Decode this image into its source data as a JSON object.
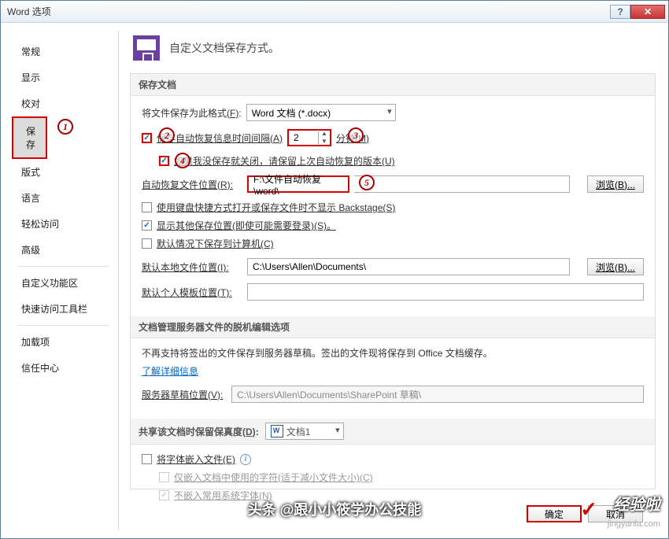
{
  "titlebar": {
    "title": "Word 选项"
  },
  "sidebar": {
    "items": [
      {
        "label": "常规"
      },
      {
        "label": "显示"
      },
      {
        "label": "校对"
      },
      {
        "label": "保存"
      },
      {
        "label": "版式"
      },
      {
        "label": "语言"
      },
      {
        "label": "轻松访问"
      },
      {
        "label": "高级"
      },
      {
        "label": "自定义功能区"
      },
      {
        "label": "快速访问工具栏"
      },
      {
        "label": "加载项"
      },
      {
        "label": "信任中心"
      }
    ]
  },
  "header": {
    "text": "自定义文档保存方式。"
  },
  "panel_save": {
    "title": "保存文档",
    "format_label_pre": "将文件保存为此格式",
    "format_label_key": "(F)",
    "format_value": "Word 文档 (*.docx)",
    "auto_recover_label": "保存自动恢复信息时间间隔(A)",
    "auto_recover_value": "2",
    "minutes_label": "分钟(M)",
    "keep_last_label": "如果我没保存就关闭，请保留上次自动恢复的版本(U)",
    "recover_loc_label": "自动恢复文件位置(R):",
    "recover_loc_value": "F:\\文件自动恢复\\word\\",
    "browse1": "浏览(B)...",
    "keyboard_label": "使用键盘快捷方式打开或保存文件时不显示 Backstage(S)",
    "show_other_label": "显示其他保存位置(即使可能需要登录)(S)。",
    "default_computer_label": "默认情况下保存到计算机(C)",
    "default_local_label": "默认本地文件位置(I):",
    "default_local_value": "C:\\Users\\Allen\\Documents\\",
    "browse2": "浏览(B)...",
    "default_template_label": "默认个人模板位置(T):",
    "default_template_value": ""
  },
  "panel_offline": {
    "title": "文档管理服务器文件的脱机编辑选项",
    "desc": "不再支持将签出的文件保存到服务器草稿。签出的文件现将保存到 Office 文档缓存。",
    "link": "了解详细信息",
    "draft_label": "服务器草稿位置(V):",
    "draft_value": "C:\\Users\\Allen\\Documents\\SharePoint 草稿\\"
  },
  "panel_share": {
    "title_pre": "共享该文档时保留保真度",
    "title_key": "(D)",
    "doc_name": "文档1",
    "embed_label": "将字体嵌入文件(E)",
    "only_used_label": "仅嵌入文档中使用的字符(适于减小文件大小)(C)",
    "not_system_label": "不嵌入常用系统字体(N)"
  },
  "footer": {
    "ok": "确定",
    "cancel": "取消"
  },
  "annotations": {
    "n1": "1",
    "n2": "2",
    "n3": "3",
    "n4": "4",
    "n5": "5",
    "headline": "头条 @跟小小筱学办公技能",
    "watermark": "经验啦",
    "watermark_url": "jingyanla.com"
  }
}
